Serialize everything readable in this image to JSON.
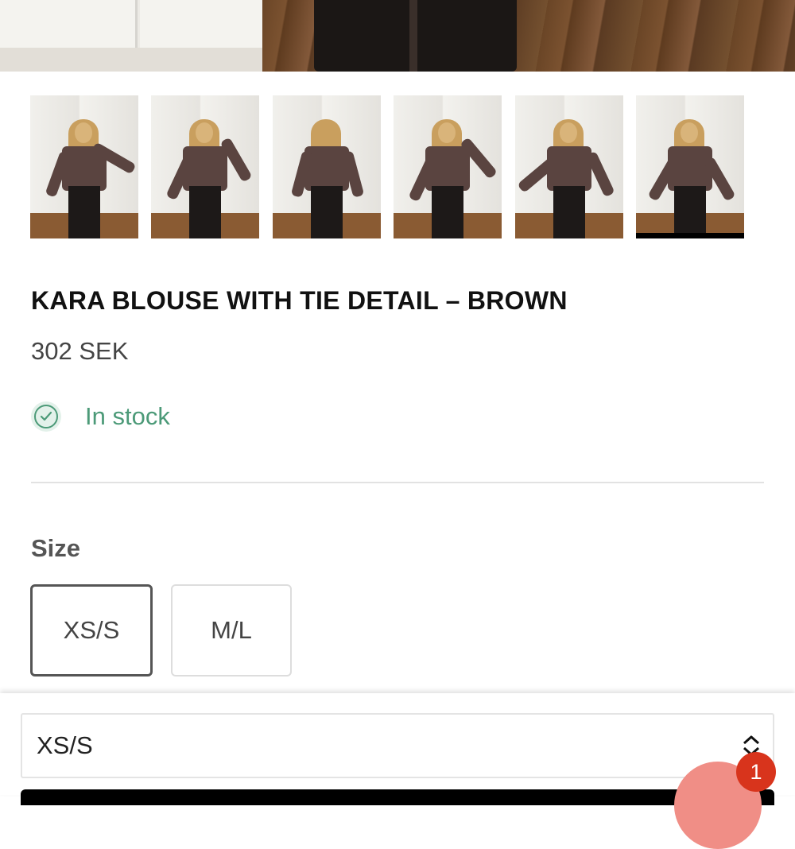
{
  "product": {
    "title": "KARA BLOUSE WITH TIE DETAIL – BROWN",
    "price": "302 SEK",
    "stock_status": "In stock",
    "stock_color": "#4c9a78"
  },
  "thumbnails": [
    {
      "selected": false
    },
    {
      "selected": false
    },
    {
      "selected": false
    },
    {
      "selected": false
    },
    {
      "selected": false
    },
    {
      "selected": true
    }
  ],
  "size": {
    "label": "Size",
    "options": [
      "XS/S",
      "M/L"
    ],
    "selected": "XS/S"
  },
  "sticky_bar": {
    "selected_variant": "XS/S"
  },
  "cart": {
    "badge_count": "1",
    "badge_color": "#d8341c"
  }
}
